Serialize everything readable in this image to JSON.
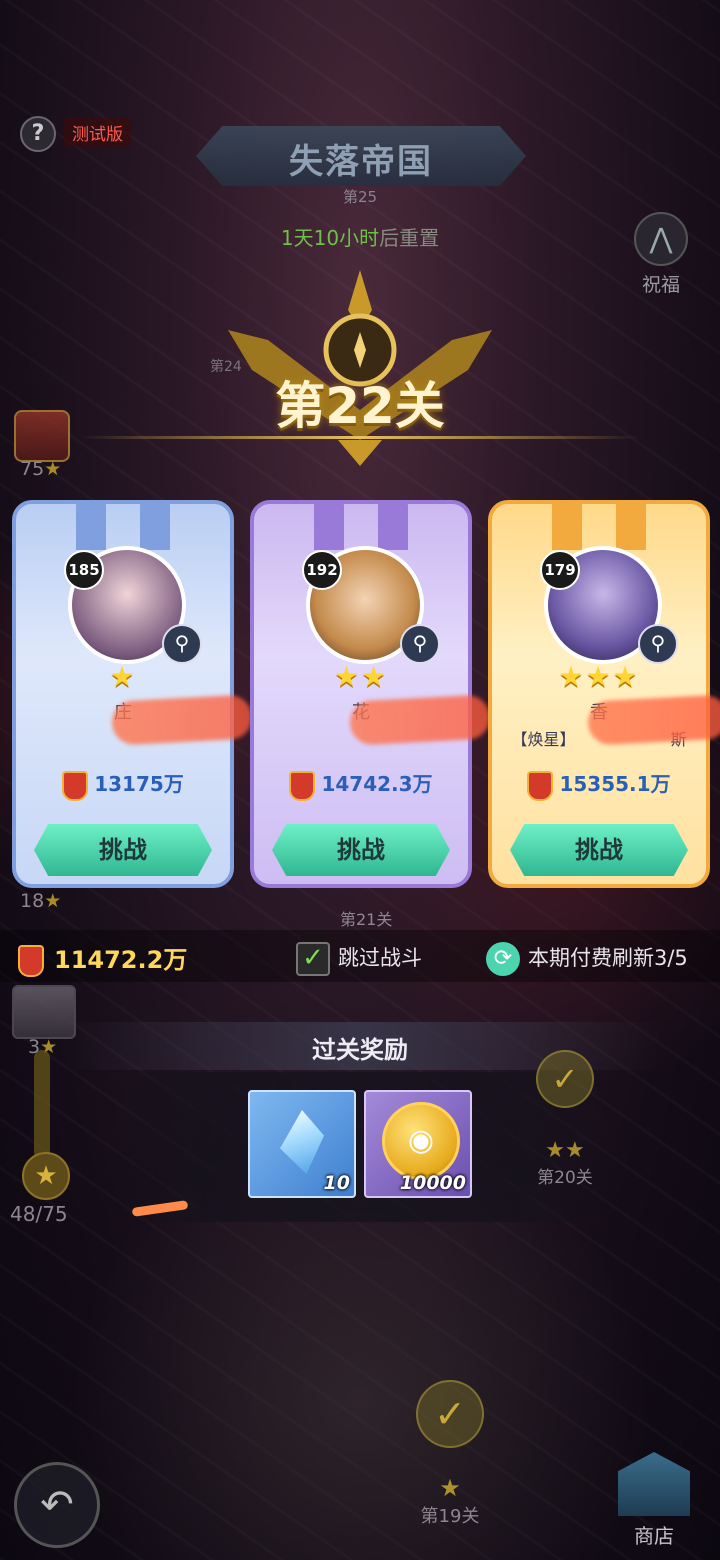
{
  "header": {
    "help_icon": "?",
    "test_badge": "测试版",
    "title": "失落帝国",
    "subtitle": "第25",
    "reset_hl": "1天10小时",
    "reset_rest": "后重置"
  },
  "bless": {
    "icon": "⋀",
    "label": "祝福"
  },
  "left_progress": {
    "chest_count": "75",
    "stage18": "18",
    "chest2_count": "3",
    "progress": "48/75"
  },
  "stage": {
    "title": "第22关",
    "prev_small": "第24"
  },
  "opponents": [
    {
      "level": "185",
      "stars": "★",
      "name": "庄",
      "guild": "",
      "power": "13175万",
      "button": "挑战"
    },
    {
      "level": "192",
      "stars": "★★",
      "name": "花",
      "guild": "",
      "power": "14742.3万",
      "button": "挑战"
    },
    {
      "level": "179",
      "stars": "★★★",
      "name": "香",
      "guild": "【焕星】",
      "guild_suffix": "斯",
      "power": "15355.1万",
      "button": "挑战"
    }
  ],
  "stage21": "第21关",
  "info": {
    "my_power": "11472.2万",
    "skip_label": "跳过战斗",
    "refresh_label": "本期付费刷新3/5"
  },
  "rewards": {
    "title": "过关奖励",
    "items": [
      {
        "name": "crystal",
        "qty": "10"
      },
      {
        "name": "gold-coin",
        "qty": "10000"
      }
    ]
  },
  "stage20": {
    "label": "第20关",
    "stars": "★★"
  },
  "stage19": {
    "label": "第19关",
    "stars": "★"
  },
  "footer": {
    "back_icon": "↶",
    "shop_label": "商店"
  }
}
